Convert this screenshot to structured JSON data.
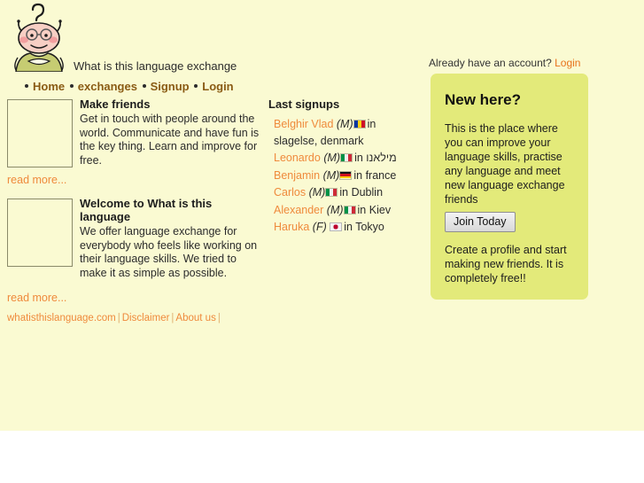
{
  "site": {
    "title": "What is this language exchange",
    "logo_icon": "alien-question-mark-logo"
  },
  "account": {
    "prompt": "Already have an account?",
    "login_label": "Login"
  },
  "nav": {
    "items": [
      {
        "label": "Home"
      },
      {
        "label": "exchanges"
      },
      {
        "label": "Signup"
      },
      {
        "label": "Login"
      }
    ]
  },
  "promos": [
    {
      "heading": "Make friends",
      "body": "Get in touch with people around the world. Communicate and have fun is the key thing. Learn and improve for free.",
      "read_more": "read more...",
      "image_name": "two-friends-studying-photo"
    },
    {
      "heading": "Welcome to What is this language",
      "body": "We offer language exchange for everybody who feels like working on their language skills. We tried to make it as simple as possible.",
      "read_more": "read more...",
      "image_name": "bagpiper-photo"
    }
  ],
  "signups": {
    "heading": "Last signups",
    "items": [
      {
        "name": "Belghir Vlad",
        "gender": "(M)",
        "flag": "romania",
        "in": "in",
        "location": "slagelse, denmark"
      },
      {
        "name": "Leonardo",
        "gender": "(M)",
        "flag": "italy",
        "in": "in",
        "location": "מילאנו"
      },
      {
        "name": "Benjamin",
        "gender": "(M)",
        "flag": "germany",
        "in": "in",
        "location": "france"
      },
      {
        "name": "Carlos",
        "gender": "(M)",
        "flag": "italy",
        "in": "in",
        "location": "Dublin"
      },
      {
        "name": "Alexander",
        "gender": "(M)",
        "flag": "italy",
        "in": "in",
        "location": "Kiev"
      },
      {
        "name": "Haruka",
        "gender": "(F)",
        "flag": "japan",
        "in": "in",
        "location": "Tokyo"
      }
    ]
  },
  "new_here": {
    "heading": "New here?",
    "body_top": "This is the place where you can improve your language skills, practise any language and meet new language exchange friends",
    "join_label": "Join Today",
    "body_bottom": "Create a profile and start making new friends. It is completely free!!"
  },
  "footer": {
    "items": [
      {
        "label": "whatisthislanguage.com"
      },
      {
        "label": "Disclaimer"
      },
      {
        "label": "About us"
      }
    ],
    "separator": "|"
  },
  "colors": {
    "page_background": "#fafad2",
    "panel_background": "#e3ea7a",
    "link_orange": "#ef8a3c",
    "nav_brown": "#8a5b14",
    "text": "#2b2b2b"
  }
}
